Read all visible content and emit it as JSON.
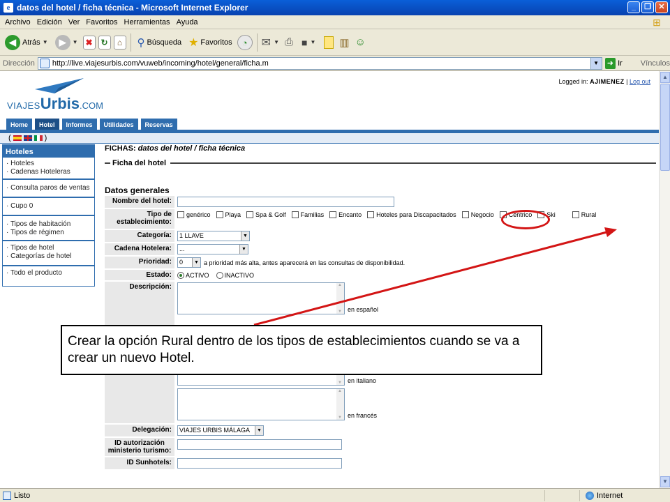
{
  "window": {
    "title": "datos del hotel / ficha técnica - Microsoft Internet Explorer"
  },
  "menu": [
    "Archivo",
    "Edición",
    "Ver",
    "Favoritos",
    "Herramientas",
    "Ayuda"
  ],
  "toolbar": {
    "back_label": "Atrás",
    "search_label": "Búsqueda",
    "favorites_label": "Favoritos"
  },
  "address": {
    "label": "Dirección",
    "url": "http://live.viajesurbis.com/vuweb/incoming/hotel/general/ficha.m",
    "go_label": "Ir",
    "links_label": "Vínculos"
  },
  "status": {
    "text": "Listo",
    "zone": "Internet"
  },
  "site": {
    "logo_part1": "VIAJES",
    "logo_part2": "Urbis",
    "logo_part3": ".COM",
    "logged_label": "Logged in:",
    "logged_user": "AJIMENEZ",
    "separator": "|",
    "logout": "Log out",
    "tabs": [
      "Home",
      "Hotel",
      "Informes",
      "Utilidades",
      "Reservas"
    ],
    "flags_open": "(",
    "flags_close": ")"
  },
  "sidebar": {
    "title": "Hoteles",
    "groups": [
      [
        "Hoteles",
        "Cadenas Hoteleras"
      ],
      [
        "Consulta paros de ventas"
      ],
      [
        "Cupo 0"
      ],
      [
        "Tipos de habitación",
        "Tipos de régimen"
      ],
      [
        "Tipos de hotel",
        "Categorías de hotel"
      ],
      [
        "Todo el producto"
      ]
    ]
  },
  "main": {
    "crumb_prefix": "FICHAS:",
    "crumb_italic": "datos del hotel / ficha técnica",
    "section_title": "Ficha del hotel",
    "subhead": "Datos generales",
    "labels": {
      "nombre": "Nombre del hotel:",
      "tipo": "Tipo de establecimiento:",
      "categoria": "Categoría:",
      "cadena": "Cadena Hotelera:",
      "prioridad": "Prioridad:",
      "estado": "Estado:",
      "descripcion": "Descripción:",
      "delegacion": "Delegación:",
      "id_autorizacion": "ID autorización ministerio turismo:",
      "id_sunhotels": "ID Sunhotels:"
    },
    "tipos": [
      "genérico",
      "Playa",
      "Spa & Golf",
      "Familias",
      "Encanto",
      "Hoteles para Discapacitados",
      "Negocio",
      "Centrico",
      "Ski",
      "Rural"
    ],
    "categoria_value": "1 LLAVE",
    "cadena_value": "...",
    "prioridad_value": "0",
    "prioridad_hint": "a prioridad más alta, antes aparecerá en las consultas de disponibilidad.",
    "estado_activo": "ACTIVO",
    "estado_inactivo": "INACTIVO",
    "langs": [
      "en español",
      "en italiano",
      "en francés"
    ],
    "delegacion_value": "VIAJES URBIS MÁLAGA"
  },
  "annotation": {
    "text": "Crear la opción Rural dentro de los tipos de establecimientos cuando se va a crear un nuevo Hotel."
  }
}
